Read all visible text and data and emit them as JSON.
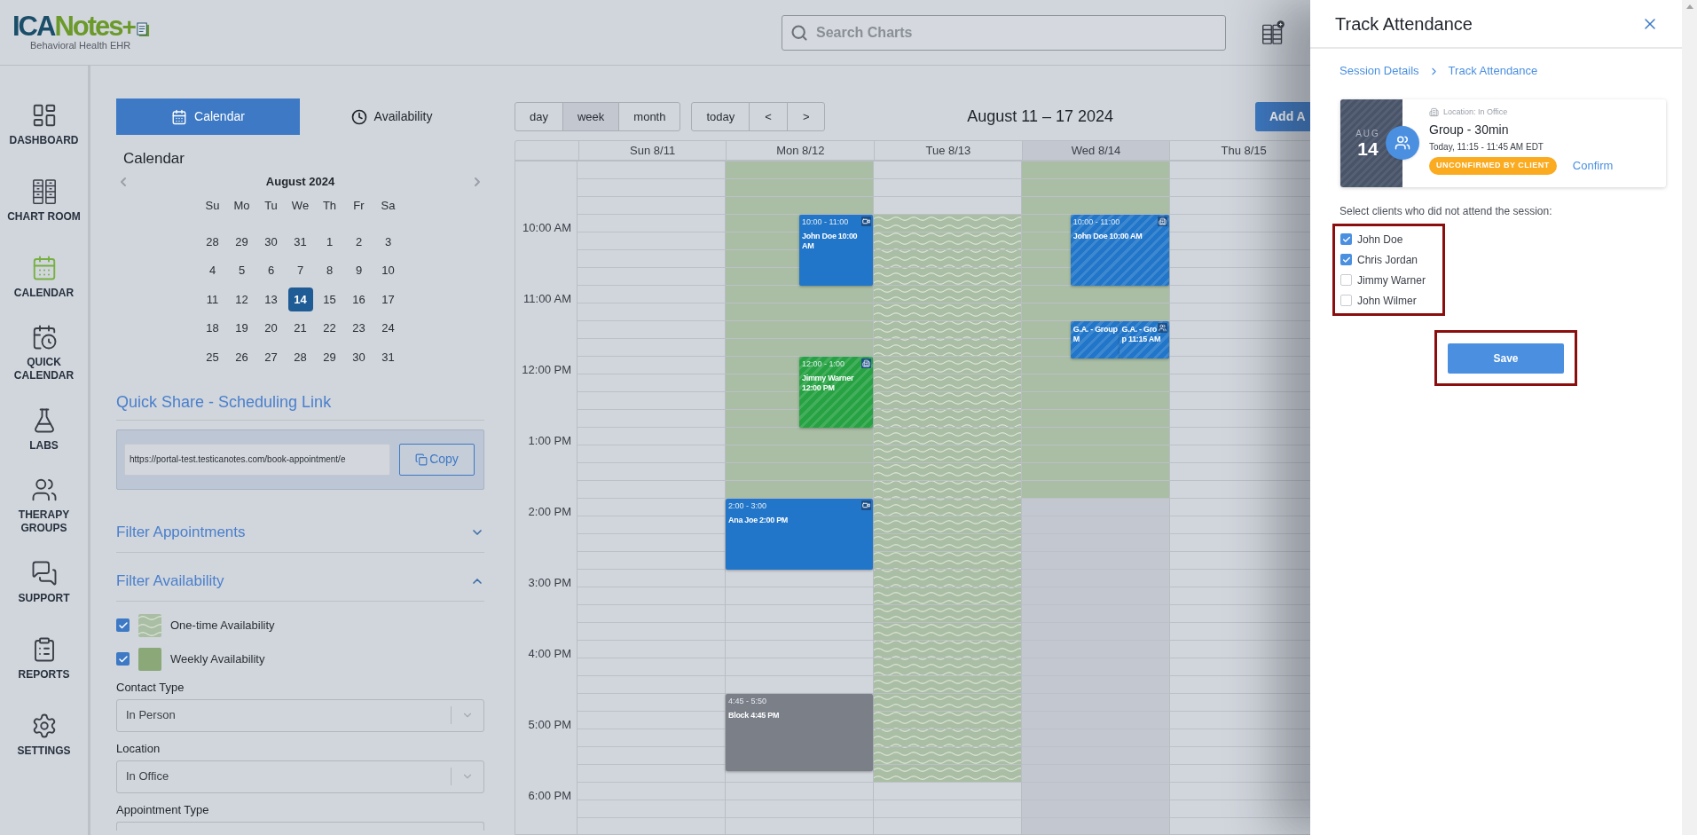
{
  "header": {
    "logo": {
      "part_1": "ICA",
      "part_2": "Notes",
      "plus": "+",
      "tagline": "Behavioral Health EHR"
    },
    "search": {
      "placeholder": "Search Charts"
    }
  },
  "nav": [
    {
      "label": "DASHBOARD",
      "kind": "dashboard",
      "selected": false
    },
    {
      "label": "CHART ROOM",
      "kind": "chart_room",
      "selected": false
    },
    {
      "label": "CALENDAR",
      "kind": "calendar",
      "selected": true
    },
    {
      "label": "QUICK CALENDAR",
      "kind": "quick_calendar",
      "selected": false
    },
    {
      "label": "LABS",
      "kind": "labs",
      "selected": false
    },
    {
      "label": "THERAPY GROUPS",
      "kind": "therapy_groups",
      "selected": false
    },
    {
      "label": "SUPPORT",
      "kind": "support",
      "selected": false
    },
    {
      "label": "REPORTS",
      "kind": "reports",
      "selected": false
    },
    {
      "label": "SETTINGS",
      "kind": "settings",
      "selected": false
    }
  ],
  "left_panel": {
    "tabs": [
      {
        "label": "Calendar",
        "kind": "calendar",
        "selected": true
      },
      {
        "label": "Availability",
        "kind": "clock",
        "selected": false
      }
    ],
    "mini_calendar": {
      "title": "Calendar",
      "month": "August 2024",
      "weekdays": [
        "Su",
        "Mo",
        "Tu",
        "We",
        "Th",
        "Fr",
        "Sa"
      ],
      "weeks": [
        [
          {
            "day": "28",
            "selected": false
          },
          {
            "day": "29",
            "selected": false
          },
          {
            "day": "30",
            "selected": false
          },
          {
            "day": "31",
            "selected": false
          },
          {
            "day": "1",
            "selected": false
          },
          {
            "day": "2",
            "selected": false
          },
          {
            "day": "3",
            "selected": false
          }
        ],
        [
          {
            "day": "4",
            "selected": false
          },
          {
            "day": "5",
            "selected": false
          },
          {
            "day": "6",
            "selected": false
          },
          {
            "day": "7",
            "selected": false
          },
          {
            "day": "8",
            "selected": false
          },
          {
            "day": "9",
            "selected": false
          },
          {
            "day": "10",
            "selected": false
          }
        ],
        [
          {
            "day": "11",
            "selected": false
          },
          {
            "day": "12",
            "selected": false
          },
          {
            "day": "13",
            "selected": false
          },
          {
            "day": "14",
            "selected": true
          },
          {
            "day": "15",
            "selected": false
          },
          {
            "day": "16",
            "selected": false
          },
          {
            "day": "17",
            "selected": false
          }
        ],
        [
          {
            "day": "18",
            "selected": false
          },
          {
            "day": "19",
            "selected": false
          },
          {
            "day": "20",
            "selected": false
          },
          {
            "day": "21",
            "selected": false
          },
          {
            "day": "22",
            "selected": false
          },
          {
            "day": "23",
            "selected": false
          },
          {
            "day": "24",
            "selected": false
          }
        ],
        [
          {
            "day": "25",
            "selected": false
          },
          {
            "day": "26",
            "selected": false
          },
          {
            "day": "27",
            "selected": false
          },
          {
            "day": "28",
            "selected": false
          },
          {
            "day": "29",
            "selected": false
          },
          {
            "day": "30",
            "selected": false
          },
          {
            "day": "31",
            "selected": false
          }
        ]
      ]
    },
    "quick_share": {
      "title": "Quick Share - Scheduling Link",
      "url": "https://portal-test.testicanotes.com/book-appointment/e",
      "copy": "Copy"
    },
    "filters": [
      {
        "title": "Filter Appointments",
        "expanded": false
      },
      {
        "title": "Filter Availability",
        "expanded": true
      }
    ],
    "availability_filters": [
      {
        "label": "One-time Availability",
        "kind": "one_time",
        "checked": true
      },
      {
        "label": "Weekly Availability",
        "kind": "weekly",
        "checked": true
      }
    ],
    "selects": [
      {
        "label": "Contact Type",
        "value": "In Person"
      },
      {
        "label": "Location",
        "value": "In Office"
      },
      {
        "label": "Appointment Type"
      }
    ]
  },
  "calendar": {
    "views": [
      {
        "label": "day",
        "selected": false
      },
      {
        "label": "week",
        "selected": true
      },
      {
        "label": "month",
        "selected": false
      }
    ],
    "nav": [
      "today",
      "<",
      ">"
    ],
    "title": "August 11 – 17 2024",
    "add_button": "Add A",
    "times": [
      "10:00 AM",
      "11:00 AM",
      "12:00 PM",
      "1:00 PM",
      "2:00 PM",
      "3:00 PM",
      "4:00 PM",
      "5:00 PM",
      "6:00 PM"
    ],
    "days": [
      {
        "label": "Sun 8/11",
        "today": false
      },
      {
        "label": "Mon 8/12",
        "today": false,
        "availability": [
          {
            "kind": "weekly"
          }
        ],
        "events": [
          {
            "time": "10:00 - 11:00",
            "lines": [
              "John Doe 10:00",
              "AM"
            ],
            "color": "#2176c9",
            "striped": false,
            "kind": "telehealth",
            "badge": true
          },
          {
            "time": "12:00 - 1:00",
            "lines": [
              "Jimmy Warner",
              "12:00 PM"
            ],
            "color": "#27a243",
            "striped": true,
            "kind": "in_office",
            "badge": true
          },
          {
            "time": "2:00 - 3:00",
            "lines": [
              "Ana Joe 2:00 PM"
            ],
            "color": "#2176c9",
            "striped": false,
            "kind": "telehealth",
            "badge": true
          },
          {
            "time": "4:45 - 5:50",
            "lines": [
              "Block 4:45 PM"
            ],
            "color": "#7a7f88",
            "striped": false,
            "kind": "block"
          }
        ]
      },
      {
        "label": "Tue 8/13",
        "today": false,
        "availability": [
          {
            "kind": "one_time"
          }
        ]
      },
      {
        "label": "Wed 8/14",
        "today": true,
        "availability": [
          {
            "kind": "weekly"
          }
        ],
        "events": [
          {
            "time": "10:00 - 11:00",
            "lines": [
              "John Doe 10:00 AM"
            ],
            "color": "#2176c9",
            "striped": true,
            "kind": "in_office",
            "badge": true
          },
          {
            "lines": [
              "G.A. - Group",
              "M"
            ],
            "color": "#2176c9",
            "striped": true,
            "kind": "group",
            "badge": false
          },
          {
            "lines": [
              "G.A. - Gro",
              "p 11:15 AM"
            ],
            "color": "#2176c9",
            "striped": true,
            "kind": "group",
            "badge": true
          }
        ]
      },
      {
        "label": "Thu 8/15",
        "today": false
      }
    ]
  },
  "drawer": {
    "title": "Track Attendance",
    "breadcrumb": [
      "Session Details",
      "Track Attendance"
    ],
    "session": {
      "month": "AUG",
      "day": "14",
      "location": "Location: In Office",
      "title": "Group - 30min",
      "time": "Today, 11:15 - 11:45 AM EDT",
      "status": "UNCONFIRMED BY CLIENT",
      "confirm": "Confirm"
    },
    "prompt": "Select clients who did not attend the session:",
    "clients": [
      {
        "name": "John Doe",
        "checked": true
      },
      {
        "name": "Chris Jordan",
        "checked": true
      },
      {
        "name": "Jimmy Warner",
        "checked": false
      },
      {
        "name": "John Wilmer",
        "checked": false
      }
    ],
    "save": "Save"
  }
}
